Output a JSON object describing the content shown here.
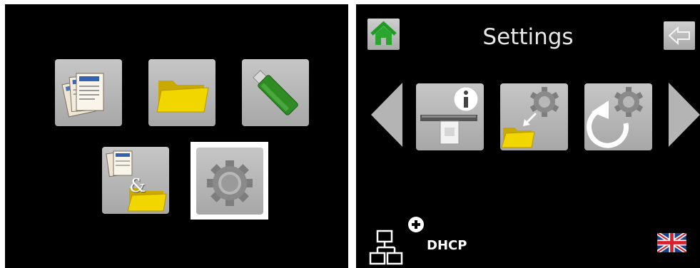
{
  "main_menu": {
    "tiles": [
      {
        "name": "documents",
        "icon": "documents-icon"
      },
      {
        "name": "folder",
        "icon": "folder-icon"
      },
      {
        "name": "usb-drive",
        "icon": "usb-drive-icon"
      },
      {
        "name": "documents-and-folder",
        "icon": "documents-folder-icon",
        "glyph": "&"
      },
      {
        "name": "settings",
        "icon": "gear-icon",
        "selected": true
      }
    ]
  },
  "settings": {
    "title": "Settings",
    "network_mode": "DHCP",
    "language_flag": "uk-flag-icon",
    "options": [
      {
        "name": "device-info",
        "icon": "info-icon"
      },
      {
        "name": "export-settings",
        "icon": "folder-gear-icon"
      },
      {
        "name": "reset-settings",
        "icon": "reset-gear-icon"
      }
    ]
  },
  "colors": {
    "panel_bg": "#000000",
    "tile_bg": "#b3b3b3",
    "folder_yellow": "#f0d200",
    "usb_green": "#2d8a22",
    "selection": "#ffffff"
  }
}
